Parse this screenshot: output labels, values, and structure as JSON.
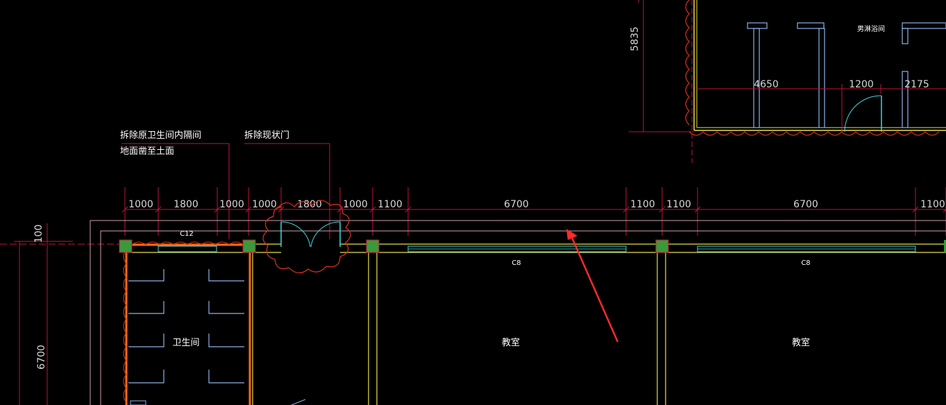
{
  "drawing": {
    "colors": {
      "background": "#000000",
      "dimension_line": "#c0143c",
      "dimension_text": "#d8d8d8",
      "wall_yellow": "#e8e04a",
      "revision_cloud": "#e03020",
      "fixture_blue": "#8fb0e8",
      "door_cyan": "#40d8e0",
      "column_green": "#3a9a3a",
      "arrow_red": "#ff2a2a",
      "demolish_orange": "#ff6a10"
    },
    "top_dimensions": [
      "1000",
      "1800",
      "1000",
      "1000",
      "1800",
      "1000",
      "1100",
      "6700",
      "1100",
      "1100",
      "6700",
      "1100"
    ],
    "upper_dimensions": [
      "4650",
      "1200",
      "2175"
    ],
    "vertical_dimensions": {
      "top_left": "100",
      "left": "6700",
      "upper": "5835"
    },
    "annotations": {
      "note1_line1": "拆除原卫生间内隔间",
      "note1_line2": "地面凿至土面",
      "note2": "拆除现状门"
    },
    "window_tags": {
      "c12": "C12",
      "c8_a": "C8",
      "c8_b": "C8"
    },
    "rooms": {
      "toilet": "卫生间",
      "class_a": "教室",
      "class_b": "教室",
      "upper_room": "男淋浴间"
    }
  }
}
